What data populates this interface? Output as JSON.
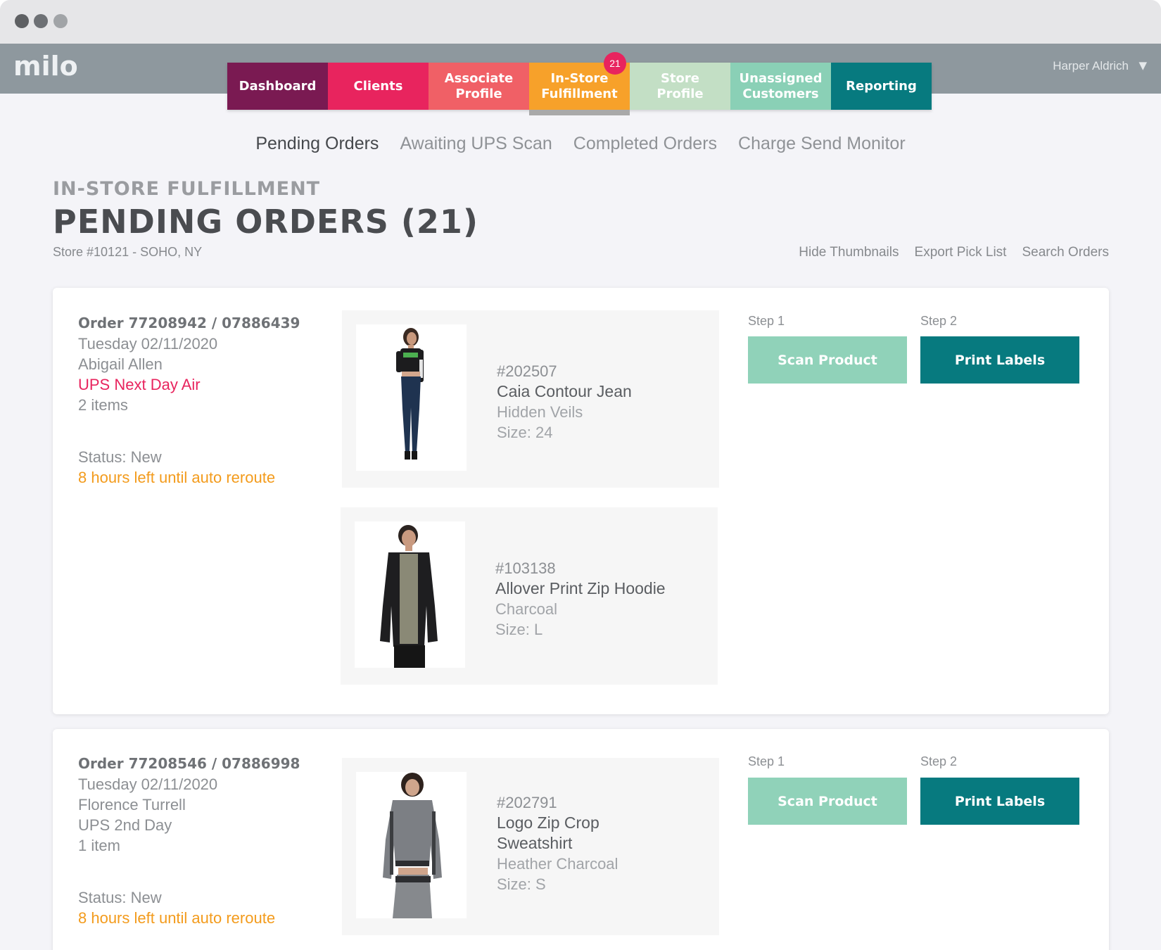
{
  "app": {
    "logo": "milo",
    "user_name": "Harper Aldrich"
  },
  "nav": {
    "tabs": [
      {
        "label": "Dashboard",
        "color": "#7a1a52"
      },
      {
        "label": "Clients",
        "color": "#e8245e"
      },
      {
        "label": "Associate\nProfile",
        "color": "#f06066"
      },
      {
        "label": "In-Store\nFulfillment",
        "color": "#f7a12a",
        "badge": "21",
        "active": true
      },
      {
        "label": "Store\nProfile",
        "color": "#c3dfc5"
      },
      {
        "label": "Unassigned\nCustomers",
        "color": "#8ad0b6"
      },
      {
        "label": "Reporting",
        "color": "#077a7f"
      }
    ]
  },
  "subtabs": [
    "Pending Orders",
    "Awaiting UPS Scan",
    "Completed Orders",
    "Charge Send Monitor"
  ],
  "header": {
    "eyebrow": "IN-STORE FULFILLMENT",
    "title": "PENDING ORDERS (21)",
    "store": "Store #10121 - SOHO, NY",
    "actions": [
      "Hide Thumbnails",
      "Export Pick List",
      "Search Orders"
    ]
  },
  "orders": [
    {
      "order_no": "Order 77208942 / 07886439",
      "date": "Tuesday 02/11/2020",
      "customer": "Abigail Allen",
      "shipping": "UPS Next Day Air",
      "items_count": "2 items",
      "status": "Status: New",
      "reroute": "8 hours left until auto reroute",
      "step1": "Step 1",
      "step2": "Step 2",
      "scan_label": "Scan Product",
      "print_label": "Print Labels",
      "items": [
        {
          "sku": "#202507",
          "name": "Caia Contour Jean",
          "color": "Hidden Veils",
          "size": "Size: 24",
          "thumb_icon": "model-jeans-photo"
        },
        {
          "sku": "#103138",
          "name": "Allover Print Zip Hoodie",
          "color": "Charcoal",
          "size": "Size: L",
          "thumb_icon": "model-hoodie-photo"
        }
      ]
    },
    {
      "order_no": "Order 77208546 / 07886998",
      "date": "Tuesday 02/11/2020",
      "customer": "Florence Turrell",
      "shipping": "UPS 2nd Day",
      "items_count": "1 item",
      "status": "Status: New",
      "reroute": "8 hours left until auto reroute",
      "step1": "Step 1",
      "step2": "Step 2",
      "scan_label": "Scan Product",
      "print_label": "Print Labels",
      "items": [
        {
          "sku": "#202791",
          "name_line1": "Logo Zip Crop",
          "name_line2": "Sweatshirt",
          "color": "Heather Charcoal",
          "size": "Size: S",
          "thumb_icon": "model-sweatshirt-photo"
        }
      ]
    }
  ]
}
